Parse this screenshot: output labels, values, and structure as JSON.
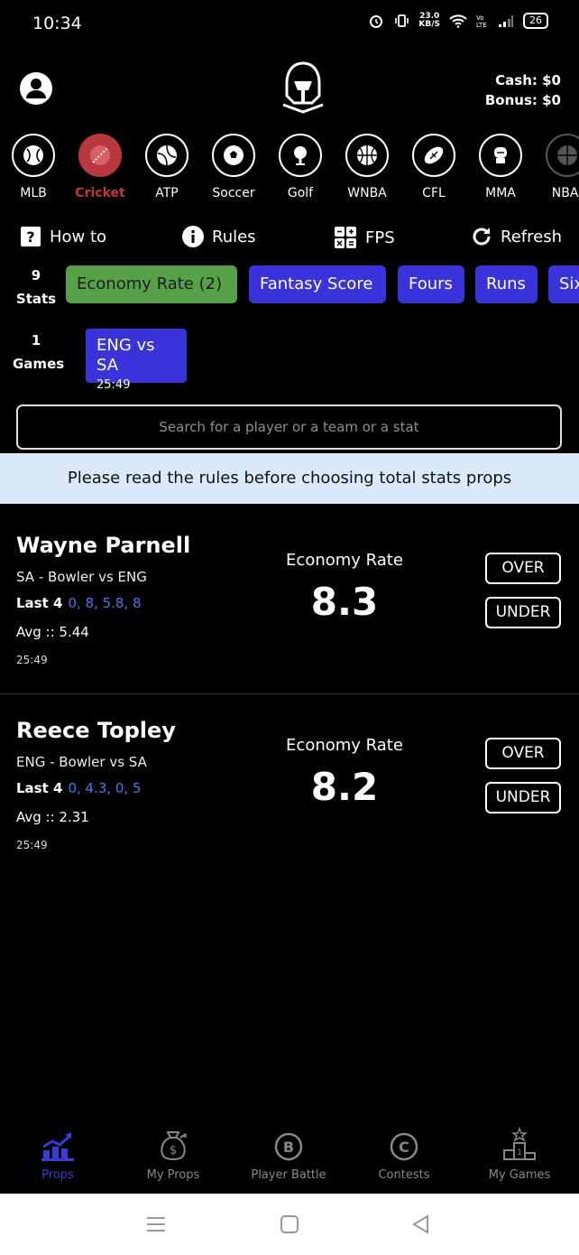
{
  "status_bar": {
    "time": "10:34",
    "net_speed": "23.0",
    "net_unit": "KB/S",
    "battery": "26",
    "icons": [
      "alarm-icon",
      "vibrate-icon",
      "wifi-icon",
      "volte-icon",
      "signal-icon",
      "battery-icon"
    ]
  },
  "header": {
    "cash": "Cash: $0",
    "bonus": "Bonus: $0"
  },
  "sports": [
    {
      "label": "MLB",
      "icon": "baseball-icon"
    },
    {
      "label": "Cricket",
      "icon": "cricket-ball-icon",
      "active": true
    },
    {
      "label": "ATP",
      "icon": "tennis-ball-icon"
    },
    {
      "label": "Soccer",
      "icon": "soccer-ball-icon"
    },
    {
      "label": "Golf",
      "icon": "golf-icon"
    },
    {
      "label": "WNBA",
      "icon": "basketball-icon"
    },
    {
      "label": "CFL",
      "icon": "football-icon"
    },
    {
      "label": "MMA",
      "icon": "mma-icon"
    },
    {
      "label": "NBA-",
      "icon": "basketball-icon"
    }
  ],
  "toolbar": {
    "how_to": "How to",
    "rules": "Rules",
    "fps": "FPS",
    "refresh": "Refresh"
  },
  "stats": {
    "count": "9",
    "label": "Stats",
    "chips": [
      "Economy Rate (2)",
      "Fantasy Score",
      "Fours",
      "Runs",
      "Sixes"
    ]
  },
  "games": {
    "count": "1",
    "label": "Games",
    "items": [
      {
        "title": "ENG vs SA",
        "countdown": "25:49"
      }
    ]
  },
  "search": {
    "placeholder": "Search for a player or a team or a stat"
  },
  "banner": "Please read the rules before choosing total stats props",
  "props": [
    {
      "name": "Wayne Parnell",
      "team": "SA - Bowler vs ENG",
      "last_label": "Last 4",
      "last_values": "0, 8, 5.8, 8",
      "avg": "Avg :: 5.44",
      "time": "25:49",
      "stat_name": "Economy Rate",
      "stat_value": "8.3",
      "over": "OVER",
      "under": "UNDER"
    },
    {
      "name": "Reece Topley",
      "team": "ENG - Bowler vs SA",
      "last_label": "Last 4",
      "last_values": "0, 4.3, 0, 5",
      "avg": "Avg :: 2.31",
      "time": "25:49",
      "stat_name": "Economy Rate",
      "stat_value": "8.2",
      "over": "OVER",
      "under": "UNDER"
    }
  ],
  "bottom_nav": [
    {
      "label": "Props",
      "icon": "chart-icon",
      "active": true
    },
    {
      "label": "My Props",
      "icon": "money-bag-icon"
    },
    {
      "label": "Player Battle",
      "icon": "b-circle-icon"
    },
    {
      "label": "Contests",
      "icon": "c-circle-icon"
    },
    {
      "label": "My Games",
      "icon": "podium-icon"
    }
  ],
  "colors": {
    "accent": "#3a33db",
    "active_chip": "#56a148",
    "cricket_active": "#c2373c",
    "banner_bg": "#dbeafb",
    "last_values": "#4b77e8"
  }
}
